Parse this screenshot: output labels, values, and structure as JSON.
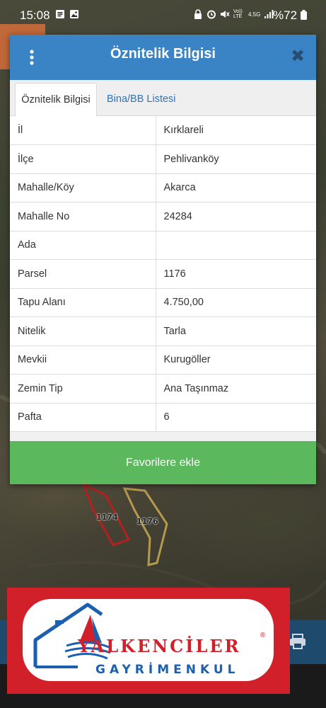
{
  "status_bar": {
    "time": "15:08",
    "left_icons": [
      "document-icon",
      "image-icon"
    ],
    "right_icons": [
      "lock-icon",
      "alarm-icon",
      "mute-icon",
      "volte-icon",
      "4g-icon",
      "signal-icon"
    ],
    "network_label": "4.5G",
    "volte_label": "Vo)) LTE",
    "battery": "%72"
  },
  "dialog": {
    "title": "Öznitelik Bilgisi",
    "tabs": [
      {
        "label": "Öznitelik Bilgisi",
        "active": true
      },
      {
        "label": "Bina/BB Listesi",
        "active": false
      }
    ],
    "rows": [
      {
        "key": "İl",
        "value": "Kırklareli"
      },
      {
        "key": "İlçe",
        "value": "Pehlivanköy"
      },
      {
        "key": "Mahalle/Köy",
        "value": "Akarca"
      },
      {
        "key": "Mahalle No",
        "value": "24284"
      },
      {
        "key": "Ada",
        "value": ""
      },
      {
        "key": "Parsel",
        "value": "1176"
      },
      {
        "key": "Tapu Alanı",
        "value": "4.750,00"
      },
      {
        "key": "Nitelik",
        "value": "Tarla"
      },
      {
        "key": "Mevkii",
        "value": "Kurugöller"
      },
      {
        "key": "Zemin Tip",
        "value": "Ana Taşınmaz"
      },
      {
        "key": "Pafta",
        "value": "6"
      }
    ],
    "favorite_button": "Favorilere ekle"
  },
  "map": {
    "parcel_labels": [
      "1174",
      "1176"
    ]
  },
  "logo": {
    "name": "YALKENCİLER",
    "subtitle": "GAYRİMENKUL",
    "registered": "®"
  },
  "colors": {
    "header": "#3a83c5",
    "tab_link": "#2f73b5",
    "button_green": "#5cb85c",
    "logo_red": "#d1202a",
    "logo_blue": "#1b5fae"
  }
}
